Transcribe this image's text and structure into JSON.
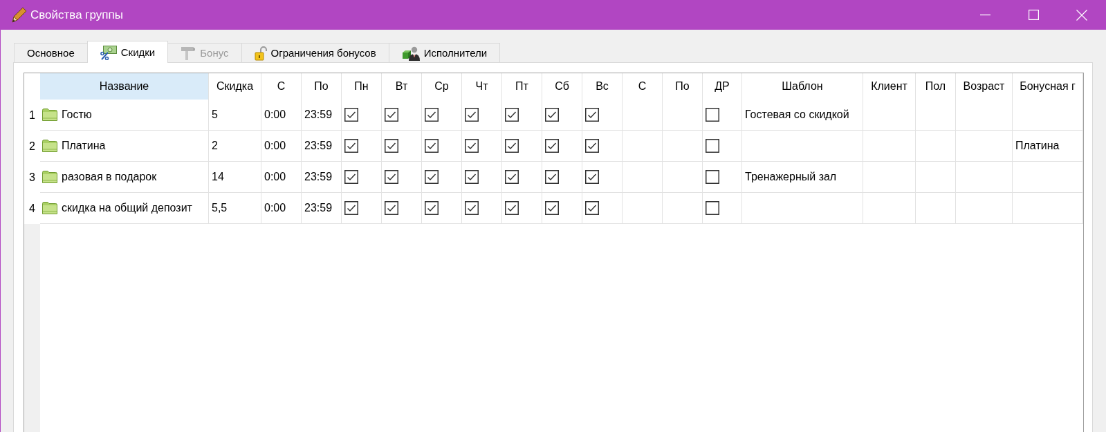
{
  "window": {
    "title": "Свойства группы"
  },
  "tabs": [
    {
      "label": "Основное",
      "selected": false,
      "disabled": false
    },
    {
      "label": "Скидки",
      "selected": true,
      "disabled": false
    },
    {
      "label": "Бонус",
      "selected": false,
      "disabled": true
    },
    {
      "label": "Ограничения бонусов",
      "selected": false,
      "disabled": false
    },
    {
      "label": "Исполнители",
      "selected": false,
      "disabled": false
    }
  ],
  "table": {
    "columns": [
      {
        "label": "Название",
        "kind": "name",
        "selected": true
      },
      {
        "label": "Скидка",
        "kind": "text",
        "selected": false
      },
      {
        "label": "С",
        "kind": "text",
        "selected": false
      },
      {
        "label": "По",
        "kind": "text",
        "selected": false
      },
      {
        "label": "Пн",
        "kind": "check",
        "selected": false
      },
      {
        "label": "Вт",
        "kind": "check",
        "selected": false
      },
      {
        "label": "Ср",
        "kind": "check",
        "selected": false
      },
      {
        "label": "Чт",
        "kind": "check",
        "selected": false
      },
      {
        "label": "Пт",
        "kind": "check",
        "selected": false
      },
      {
        "label": "Сб",
        "kind": "check",
        "selected": false
      },
      {
        "label": "Вс",
        "kind": "check",
        "selected": false
      },
      {
        "label": "С",
        "kind": "text",
        "selected": false
      },
      {
        "label": "По",
        "kind": "text",
        "selected": false
      },
      {
        "label": "ДР",
        "kind": "check",
        "selected": false
      },
      {
        "label": "Шаблон",
        "kind": "text",
        "selected": false
      },
      {
        "label": "Клиент",
        "kind": "text",
        "selected": false
      },
      {
        "label": "Пол",
        "kind": "text",
        "selected": false
      },
      {
        "label": "Возраст",
        "kind": "text",
        "selected": false
      },
      {
        "label": "Бонусная г",
        "kind": "text",
        "selected": false
      }
    ],
    "rows": [
      {
        "number": "1",
        "cells": [
          {
            "text": "Гостю"
          },
          {
            "text": "5"
          },
          {
            "text": "0:00"
          },
          {
            "text": "23:59"
          },
          {
            "checked": true
          },
          {
            "checked": true
          },
          {
            "checked": true
          },
          {
            "checked": true
          },
          {
            "checked": true
          },
          {
            "checked": true
          },
          {
            "checked": true
          },
          {},
          {},
          {
            "checked": false
          },
          {
            "text": "Гостевая со скидкой"
          },
          {},
          {},
          {},
          {}
        ]
      },
      {
        "number": "2",
        "cells": [
          {
            "text": "Платина"
          },
          {
            "text": "2"
          },
          {
            "text": "0:00"
          },
          {
            "text": "23:59"
          },
          {
            "checked": true
          },
          {
            "checked": true
          },
          {
            "checked": true
          },
          {
            "checked": true
          },
          {
            "checked": true
          },
          {
            "checked": true
          },
          {
            "checked": true
          },
          {},
          {},
          {
            "checked": false
          },
          {},
          {},
          {},
          {},
          {
            "text": "Платина"
          }
        ]
      },
      {
        "number": "3",
        "cells": [
          {
            "text": "разовая в подарок"
          },
          {
            "text": "14"
          },
          {
            "text": "0:00"
          },
          {
            "text": "23:59"
          },
          {
            "checked": true
          },
          {
            "checked": true
          },
          {
            "checked": true
          },
          {
            "checked": true
          },
          {
            "checked": true
          },
          {
            "checked": true
          },
          {
            "checked": true
          },
          {},
          {},
          {
            "checked": false
          },
          {
            "text": "Тренажерный зал"
          },
          {},
          {},
          {},
          {}
        ]
      },
      {
        "number": "4",
        "cells": [
          {
            "text": "скидка на общий депозит"
          },
          {
            "text": "5,5"
          },
          {
            "text": "0:00"
          },
          {
            "text": "23:59"
          },
          {
            "checked": true
          },
          {
            "checked": true
          },
          {
            "checked": true
          },
          {
            "checked": true
          },
          {
            "checked": true
          },
          {
            "checked": true
          },
          {
            "checked": true
          },
          {},
          {},
          {
            "checked": false
          },
          {},
          {},
          {},
          {},
          {}
        ]
      }
    ]
  }
}
